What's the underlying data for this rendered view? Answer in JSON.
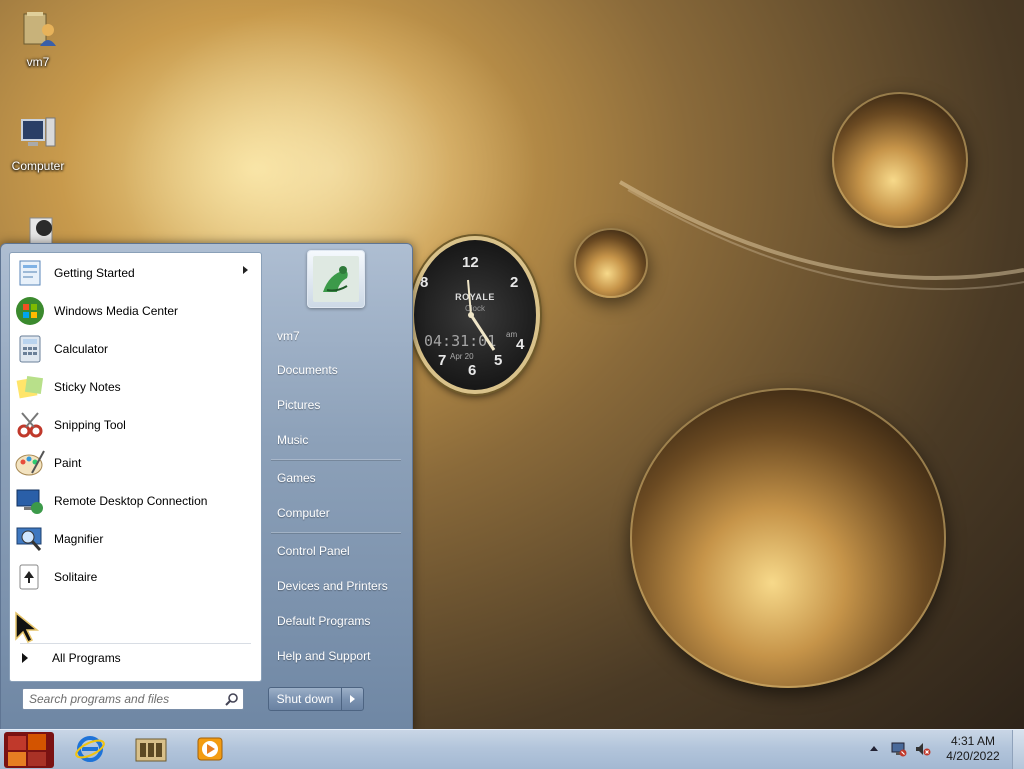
{
  "desktop": {
    "icons": [
      {
        "label": "vm7",
        "icon": "user-folder-icon"
      },
      {
        "label": "Computer",
        "icon": "computer-icon"
      }
    ]
  },
  "clock_gadget": {
    "numbers": [
      "12",
      "2",
      "4",
      "5",
      "6",
      "7",
      "8"
    ],
    "brand": "ROYALE",
    "sub": "Clock",
    "digital": "04:31:01",
    "ampm": "am",
    "date": "Apr 20"
  },
  "start_menu": {
    "programs": [
      {
        "label": "Getting Started",
        "icon": "getting-started-icon",
        "submenu": true
      },
      {
        "label": "Windows Media Center",
        "icon": "windows-media-center-icon"
      },
      {
        "label": "Calculator",
        "icon": "calculator-icon"
      },
      {
        "label": "Sticky Notes",
        "icon": "sticky-notes-icon"
      },
      {
        "label": "Snipping Tool",
        "icon": "snipping-tool-icon"
      },
      {
        "label": "Paint",
        "icon": "paint-icon"
      },
      {
        "label": "Remote Desktop Connection",
        "icon": "remote-desktop-icon"
      },
      {
        "label": "Magnifier",
        "icon": "magnifier-icon"
      },
      {
        "label": "Solitaire",
        "icon": "solitaire-icon"
      }
    ],
    "all_programs": "All Programs",
    "search_placeholder": "Search programs and files",
    "right_items": [
      "vm7",
      "Documents",
      "Pictures",
      "Music",
      "Games",
      "Computer",
      "Control Panel",
      "Devices and Printers",
      "Default Programs",
      "Help and Support"
    ],
    "shutdown_label": "Shut down"
  },
  "taskbar": {
    "pinned": [
      "internet-explorer-icon",
      "windows-explorer-icon",
      "windows-media-player-icon"
    ],
    "tray": {
      "time": "4:31 AM",
      "date": "4/20/2022",
      "icons": [
        "network-icon",
        "volume-muted-icon"
      ]
    }
  }
}
